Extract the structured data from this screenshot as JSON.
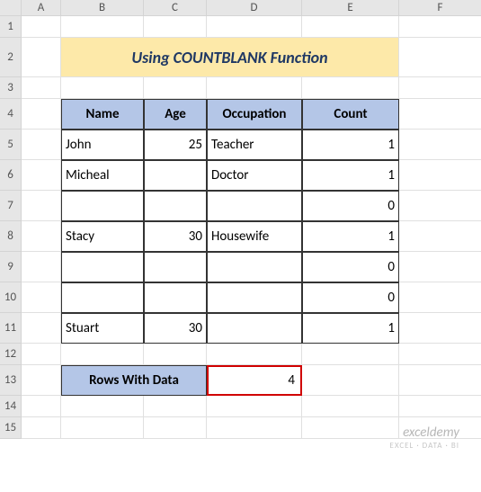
{
  "columns": [
    "",
    "A",
    "B",
    "C",
    "D",
    "E",
    "F"
  ],
  "rows": [
    "1",
    "2",
    "3",
    "4",
    "5",
    "6",
    "7",
    "8",
    "9",
    "10",
    "11",
    "12",
    "13",
    "14",
    "15"
  ],
  "title": "Using COUNTBLANK Function",
  "headers": {
    "name": "Name",
    "age": "Age",
    "occupation": "Occupation",
    "count": "Count"
  },
  "chart_data": {
    "type": "table",
    "columns": [
      "Name",
      "Age",
      "Occupation",
      "Count"
    ],
    "rows": [
      {
        "name": "John",
        "age": 25,
        "occupation": "Teacher",
        "count": 1
      },
      {
        "name": "Micheal",
        "age": "",
        "occupation": "Doctor",
        "count": 1
      },
      {
        "name": "",
        "age": "",
        "occupation": "",
        "count": 0
      },
      {
        "name": "Stacy",
        "age": 30,
        "occupation": "Housewife",
        "count": 1
      },
      {
        "name": "",
        "age": "",
        "occupation": "",
        "count": 0
      },
      {
        "name": "",
        "age": "",
        "occupation": "",
        "count": 0
      },
      {
        "name": "Stuart",
        "age": 30,
        "occupation": "",
        "count": 1
      }
    ]
  },
  "summary": {
    "label": "Rows With Data",
    "value": 4
  },
  "watermark": {
    "main": "exceldemy",
    "sub": "EXCEL · DATA · BI"
  }
}
